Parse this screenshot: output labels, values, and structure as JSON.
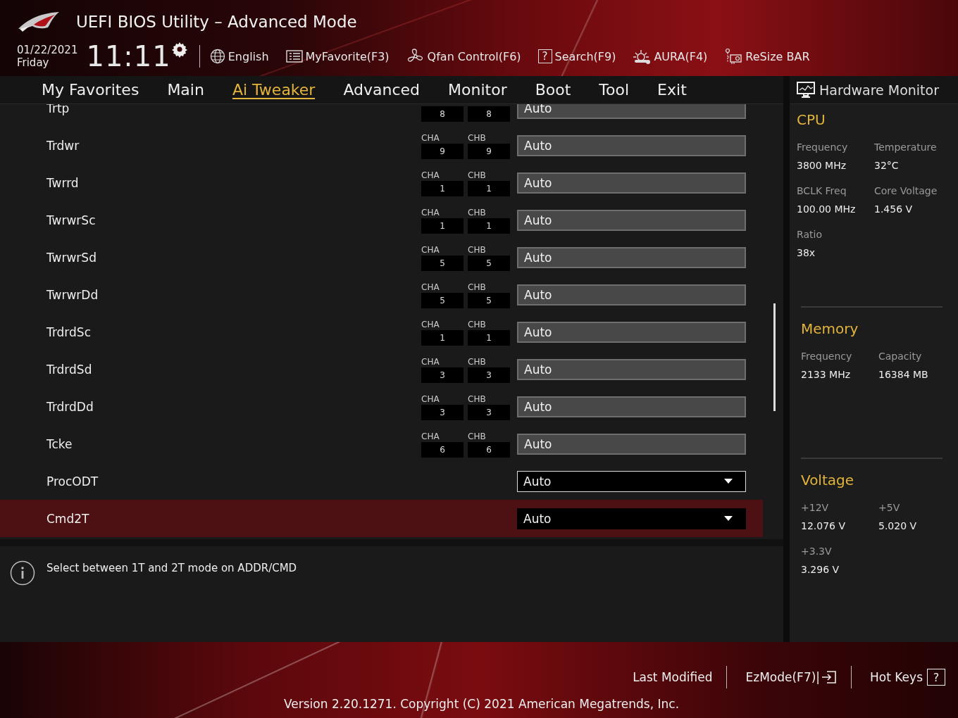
{
  "header": {
    "title": "UEFI BIOS Utility – Advanced Mode",
    "date": "01/22/2021",
    "day": "Friday",
    "time": "11:11",
    "toolbar": [
      {
        "kind": "language",
        "label": "English"
      },
      {
        "kind": "favorite",
        "label": "MyFavorite(F3)"
      },
      {
        "kind": "fan",
        "label": "Qfan Control(F6)"
      },
      {
        "kind": "search",
        "glyph": "?",
        "label": "Search(F9)"
      },
      {
        "kind": "aura",
        "label": "AURA(F4)"
      },
      {
        "kind": "resize",
        "label": "ReSize BAR"
      }
    ]
  },
  "tabs": [
    {
      "label": "My Favorites",
      "selected": false
    },
    {
      "label": "Main",
      "selected": false
    },
    {
      "label": "Ai Tweaker",
      "selected": true
    },
    {
      "label": "Advanced",
      "selected": false
    },
    {
      "label": "Monitor",
      "selected": false
    },
    {
      "label": "Boot",
      "selected": false
    },
    {
      "label": "Tool",
      "selected": false
    },
    {
      "label": "Exit",
      "selected": false
    }
  ],
  "settings": [
    {
      "kind": "timing",
      "label": "Trtp",
      "cha": "8",
      "chb": "8",
      "value": "Auto",
      "selected": false
    },
    {
      "kind": "timing",
      "label": "Trdwr",
      "cha_label": "CHA",
      "cha": "9",
      "chb_label": "CHB",
      "chb": "9",
      "value": "Auto",
      "selected": false
    },
    {
      "kind": "timing",
      "label": "Twrrd",
      "cha_label": "CHA",
      "cha": "1",
      "chb_label": "CHB",
      "chb": "1",
      "value": "Auto",
      "selected": false
    },
    {
      "kind": "timing",
      "label": "TwrwrSc",
      "cha_label": "CHA",
      "cha": "1",
      "chb_label": "CHB",
      "chb": "1",
      "value": "Auto",
      "selected": false
    },
    {
      "kind": "timing",
      "label": "TwrwrSd",
      "cha_label": "CHA",
      "cha": "5",
      "chb_label": "CHB",
      "chb": "5",
      "value": "Auto",
      "selected": false
    },
    {
      "kind": "timing",
      "label": "TwrwrDd",
      "cha_label": "CHA",
      "cha": "5",
      "chb_label": "CHB",
      "chb": "5",
      "value": "Auto",
      "selected": false
    },
    {
      "kind": "timing",
      "label": "TrdrdSc",
      "cha_label": "CHA",
      "cha": "1",
      "chb_label": "CHB",
      "chb": "1",
      "value": "Auto",
      "selected": false
    },
    {
      "kind": "timing",
      "label": "TrdrdSd",
      "cha_label": "CHA",
      "cha": "3",
      "chb_label": "CHB",
      "chb": "3",
      "value": "Auto",
      "selected": false
    },
    {
      "kind": "timing",
      "label": "TrdrdDd",
      "cha_label": "CHA",
      "cha": "3",
      "chb_label": "CHB",
      "chb": "3",
      "value": "Auto",
      "selected": false
    },
    {
      "kind": "timing",
      "label": "Tcke",
      "cha_label": "CHA",
      "cha": "6",
      "chb_label": "CHB",
      "chb": "6",
      "value": "Auto",
      "selected": false
    },
    {
      "kind": "dropdown",
      "label": "ProcODT",
      "value": "Auto",
      "selected": false
    },
    {
      "kind": "dropdown",
      "label": "Cmd2T",
      "value": "Auto",
      "selected": true
    }
  ],
  "help": "Select between 1T and 2T mode on ADDR/CMD",
  "hardware_monitor": {
    "title": "Hardware Monitor",
    "sections": [
      {
        "title": "CPU",
        "items": [
          {
            "label": "Frequency",
            "value": "3800 MHz"
          },
          {
            "label": "Temperature",
            "value": "32°C"
          },
          {
            "label": "BCLK Freq",
            "value": "100.00 MHz"
          },
          {
            "label": "Core Voltage",
            "value": "1.456 V"
          },
          {
            "label": "Ratio",
            "value": "38x"
          }
        ]
      },
      {
        "title": "Memory",
        "items": [
          {
            "label": "Frequency",
            "value": "2133 MHz"
          },
          {
            "label": "Capacity",
            "value": "16384 MB"
          }
        ]
      },
      {
        "title": "Voltage",
        "items": [
          {
            "label": "+12V",
            "value": "12.076 V"
          },
          {
            "label": "+5V",
            "value": "5.020 V"
          },
          {
            "label": "+3.3V",
            "value": "3.296 V"
          }
        ]
      }
    ]
  },
  "footer": {
    "last_modified": "Last Modified",
    "ezmode": "EzMode(F7)|",
    "hot_keys": "Hot Keys",
    "hot_keys_glyph": "?",
    "version": "Version 2.20.1271. Copyright (C) 2021 American Megatrends, Inc."
  }
}
